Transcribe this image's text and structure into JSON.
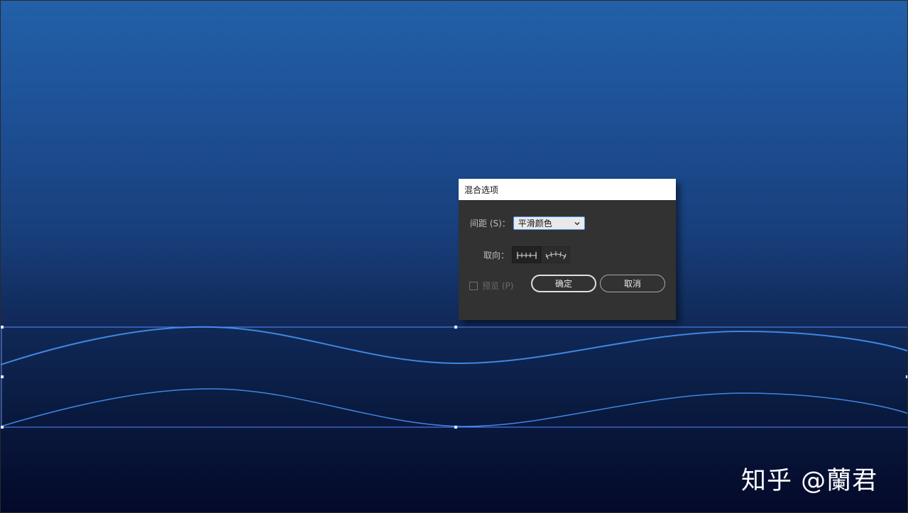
{
  "dialog": {
    "title": "混合选项",
    "spacing_label": "间距 (S)：",
    "spacing_value": "平滑颜色",
    "orientation_label": "取向：",
    "preview_label": "预览 (P)",
    "preview_checked": false,
    "ok_label": "确定",
    "cancel_label": "取消"
  },
  "icons": {
    "spacing_dropdown": "chevron-down-icon",
    "orient_page": "align-to-page-icon",
    "orient_path": "align-to-path-icon"
  },
  "watermark": {
    "text": "知乎 @蘭君"
  },
  "colors": {
    "path_stroke": "#3f86e0",
    "selection": "#5a8cff",
    "focus": "#4d8ee8"
  }
}
